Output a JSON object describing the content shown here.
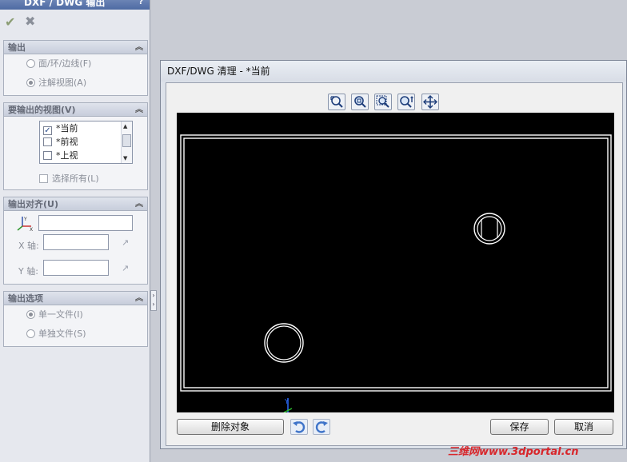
{
  "property_manager": {
    "title": "DXF / DWG 输出",
    "help": "?",
    "ok_icon": "✔",
    "cancel_icon": "✖",
    "output": {
      "header": "输出",
      "options": [
        {
          "label": "面/环/边线(F)",
          "selected": false
        },
        {
          "label": "注解视图(A)",
          "selected": true
        }
      ]
    },
    "views": {
      "header": "要输出的视图(V)",
      "items": [
        {
          "label": "*当前",
          "checked": true
        },
        {
          "label": "*前视",
          "checked": false
        },
        {
          "label": "*上视",
          "checked": false
        }
      ],
      "select_all": "选择所有(L)"
    },
    "alignment": {
      "header": "输出对齐(U)",
      "origin_value": "",
      "x_label": "X 轴:",
      "x_value": "",
      "y_label": "Y 轴:",
      "y_value": ""
    },
    "export_options": {
      "header": "输出选项",
      "options": [
        {
          "label": "单一文件(I)",
          "selected": true
        },
        {
          "label": "单独文件(S)",
          "selected": false
        }
      ]
    }
  },
  "dialog": {
    "title": "DXF/DWG 清理 - *当前",
    "toolbar": [
      "zoom-fit-icon",
      "zoom-window-icon",
      "zoom-box-icon",
      "zoom-in-out-icon",
      "pan-icon"
    ],
    "preview": {
      "background": "#000000",
      "outline_color": "#ffffff",
      "triad_y_color": "#2a6cff",
      "triad_x_color": "#2cbc2c",
      "triad_label": "Y"
    },
    "delete_button": "删除对象",
    "undo_icon": "undo-icon",
    "redo_icon": "redo-icon",
    "save_button": "保存",
    "cancel_button": "取消"
  },
  "watermark": "三维网www.3dportal.cn"
}
